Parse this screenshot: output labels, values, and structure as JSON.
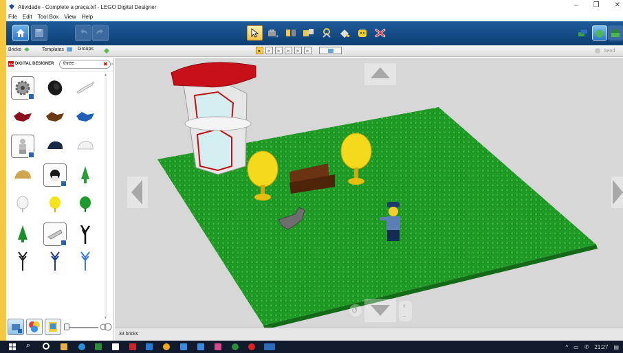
{
  "window": {
    "title": "Atividade - Complete a praça.lxf - LEGO Digital Designer",
    "controls": {
      "minimize": "–",
      "maximize": "❐",
      "close": "✕"
    }
  },
  "menu": [
    "File",
    "Edit",
    "Tool Box",
    "View",
    "Help"
  ],
  "toolbar": {
    "tools": [
      "select",
      "clone",
      "hinge",
      "hinge-align",
      "flex",
      "paint",
      "hide",
      "delete"
    ],
    "selected_tool": "select",
    "right_send": "Send"
  },
  "palette": {
    "tabs": [
      {
        "label": "Bricks"
      },
      {
        "label": "Templates"
      },
      {
        "label": "Groups"
      }
    ],
    "logo_text": "DIGITAL DESIGNER",
    "search": {
      "value": "three"
    },
    "bricks": [
      [
        "gear-brick",
        "tire-brick",
        "propeller-brick"
      ],
      [
        "red-plant-brick",
        "brown-plant-brick",
        "blue-plant-brick"
      ],
      [
        "minifig-brick",
        "navy-cap-brick",
        "white-cap-brick"
      ],
      [
        "tan-helmet-brick",
        "hair-brick",
        "green-tree-brick"
      ],
      [
        "white-bush-brick",
        "yellow-bush-brick",
        "green-bush-brick"
      ],
      [
        "cone-tree-brick",
        "grey-hat-brick",
        "black-claw-brick"
      ],
      [
        "black-branch-brick",
        "blue-branch-brick",
        "lightblue-branch-brick"
      ]
    ]
  },
  "viewport": {
    "scene": [
      "baseplate",
      "tower-building",
      "yellow-tree-left",
      "yellow-tree-right",
      "brown-bench",
      "grey-dog",
      "police-minifigure"
    ]
  },
  "status": {
    "bricks_count": "33 bricks"
  },
  "taskbar": {
    "time": "21:27"
  },
  "colors": {
    "baseplate": "#1e9a24",
    "toolbar": "#1b4f8a",
    "taskbar": "#101a2c"
  }
}
